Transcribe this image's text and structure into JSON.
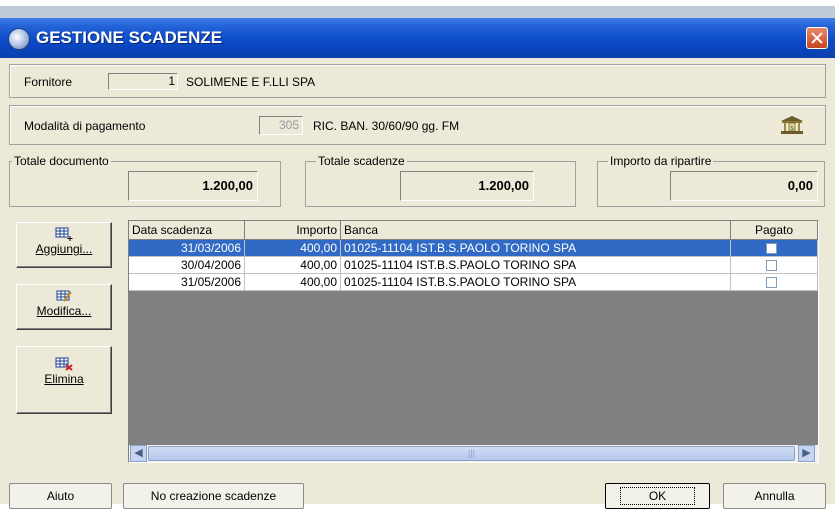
{
  "window": {
    "title": "GESTIONE SCADENZE"
  },
  "supplier": {
    "label": "Fornitore",
    "code": "1",
    "name": "SOLIMENE E F.LLI SPA"
  },
  "payment": {
    "label": "Modalità di pagamento",
    "code": "305",
    "description": "RIC. BAN. 30/60/90 gg. FM"
  },
  "totals": {
    "document": {
      "label": "Totale documento",
      "value": "1.200,00"
    },
    "due": {
      "label": "Totale scadenze",
      "value": "1.200,00"
    },
    "remaining": {
      "label": "Importo da ripartire",
      "value": "0,00"
    }
  },
  "side_buttons": {
    "add": "Aggiungi...",
    "edit": "Modifica...",
    "delete": "Elimina"
  },
  "grid": {
    "columns": [
      "Data scadenza",
      "Importo",
      "Banca",
      "Pagato"
    ],
    "rows": [
      {
        "date": "31/03/2006",
        "amount": "400,00",
        "bank": "01025-11104 IST.B.S.PAOLO TORINO SPA",
        "paid": false,
        "selected": true
      },
      {
        "date": "30/04/2006",
        "amount": "400,00",
        "bank": "01025-11104 IST.B.S.PAOLO TORINO SPA",
        "paid": false,
        "selected": false
      },
      {
        "date": "31/05/2006",
        "amount": "400,00",
        "bank": "01025-11104 IST.B.S.PAOLO TORINO SPA",
        "paid": false,
        "selected": false
      }
    ]
  },
  "bottom_buttons": {
    "help": "Aiuto",
    "no_create": "No creazione scadenze",
    "ok": "OK",
    "cancel": "Annulla"
  },
  "colors": {
    "title_bar": "#0a49c7",
    "selection": "#316ac5",
    "dialog_bg": "#ece9d8",
    "grid_empty": "#808080"
  },
  "icons": {
    "title": "app-globe-icon",
    "bank": "bank-icon",
    "add": "add-row-icon",
    "edit": "edit-row-icon",
    "delete": "delete-row-icon"
  }
}
